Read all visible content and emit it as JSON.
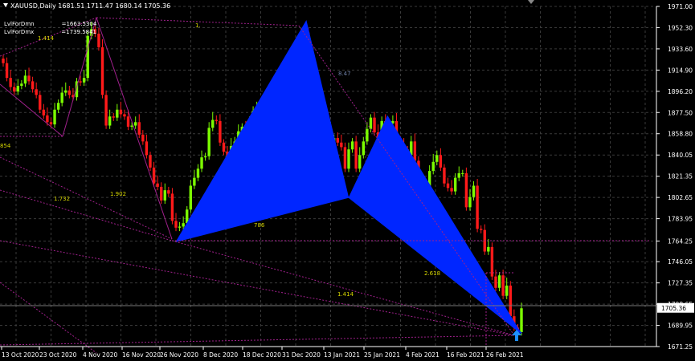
{
  "header": {
    "symbol_line": "XAUUSD,Daily  1681.51 1711.47 1680.14 1705.36"
  },
  "indicators": [
    {
      "label": "LvlForDmn",
      "value": "1663.5304"
    },
    {
      "label": "LvlForDmx",
      "value": "1739.5841"
    }
  ],
  "colors": {
    "background": "#000000",
    "grid": "#3a3a3a",
    "bull": "#7cfc00",
    "bear": "#ff1a1a",
    "pattern_fill": "#0026ff",
    "pattern_line": "#a0208c",
    "fib_label": "#d4d400",
    "axis_text": "#ffffff"
  },
  "icons": {
    "arrow": "up-arrow-icon",
    "menu": "dropdown-triangle-icon"
  },
  "chart_data": {
    "type": "candlestick",
    "symbol": "XAUUSD",
    "timeframe": "Daily",
    "ylim": [
      1671.25,
      1971.0
    ],
    "y_ticks": [
      "1971.00",
      "1952.30",
      "1933.60",
      "1914.90",
      "1896.20",
      "1877.50",
      "1858.80",
      "1840.05",
      "1821.35",
      "1802.65",
      "1783.95",
      "1764.25",
      "1746.05",
      "1727.35",
      "1708.65",
      "1689.95",
      "1671.25"
    ],
    "x_ticks": [
      "13 Oct 2020",
      "23 Oct 2020",
      "4 Nov 2020",
      "16 Nov 2020",
      "26 Nov 2020",
      "8 Dec 2020",
      "18 Dec 2020",
      "31 Dec 2020",
      "13 Jan 2021",
      "25 Jan 2021",
      "4 Feb 2021",
      "16 Feb 2021",
      "26 Feb 2021"
    ],
    "current_price": "1705.36",
    "close_prices": [
      1921,
      1908,
      1900,
      1896,
      1901,
      1903,
      1910,
      1905,
      1898,
      1893,
      1880,
      1875,
      1869,
      1867,
      1880,
      1886,
      1895,
      1897,
      1893,
      1891,
      1905,
      1904,
      1908,
      1945,
      1951,
      1947,
      1935,
      1893,
      1866,
      1874,
      1873,
      1880,
      1876,
      1874,
      1865,
      1866,
      1869,
      1858,
      1852,
      1840,
      1829,
      1815,
      1812,
      1800,
      1809,
      1806,
      1782,
      1776,
      1777,
      1780,
      1792,
      1813,
      1820,
      1828,
      1838,
      1839,
      1864,
      1871,
      1870,
      1851,
      1843,
      1834,
      1848,
      1852,
      1861,
      1865,
      1860,
      1867,
      1879,
      1881,
      1876,
      1860,
      1870,
      1861,
      1878,
      1883,
      1892,
      1889,
      1889,
      1902,
      1913,
      1942,
      1948,
      1916,
      1907,
      1893,
      1867,
      1850,
      1842,
      1837,
      1855,
      1851,
      1847,
      1828,
      1845,
      1852,
      1828,
      1840,
      1852,
      1863,
      1873,
      1860,
      1843,
      1870,
      1855,
      1868,
      1870,
      1853,
      1849,
      1845,
      1840,
      1852,
      1835,
      1796,
      1800,
      1813,
      1826,
      1834,
      1840,
      1829,
      1815,
      1811,
      1808,
      1820,
      1824,
      1824,
      1794,
      1803,
      1813,
      1775,
      1774,
      1755,
      1759,
      1733,
      1723,
      1734,
      1716,
      1725,
      1698,
      1688,
      1684,
      1705
    ],
    "harmonic_pattern": {
      "points": [
        {
          "label": "X",
          "date": "2020-11-30",
          "price": 1764
        },
        {
          "label": "A",
          "date": "2021-01-06",
          "price": 1959
        },
        {
          "label": "B",
          "date": "2021-01-18",
          "price": 1803
        },
        {
          "label": "C",
          "date": "2021-01-29",
          "price": 1875
        },
        {
          "label": "D",
          "date": "2021-03-08",
          "price": 1683
        }
      ],
      "ratio_labels": [
        "786",
        "2.618",
        "1.414",
        "1.902",
        "1.732",
        "1.414",
        "854",
        "1.",
        "8.47"
      ]
    },
    "grid": true
  }
}
